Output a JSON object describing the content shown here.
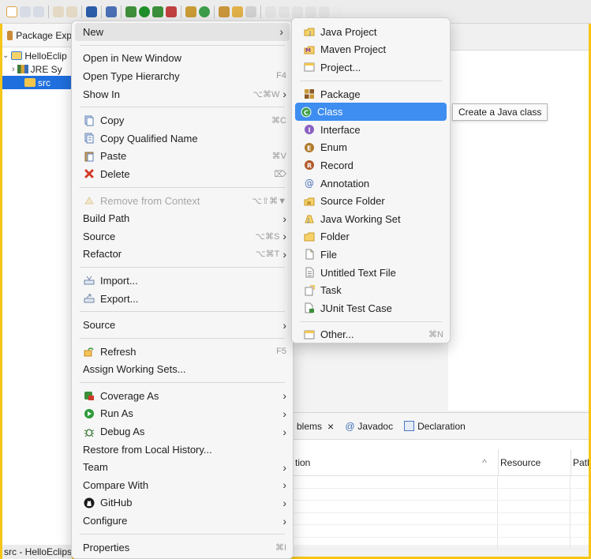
{
  "package_explorer": {
    "tab_label": "Package Exp",
    "project": "HelloEclip",
    "jre": "JRE Sy",
    "src": "src"
  },
  "status_bar": {
    "text": "src - HelloEclips"
  },
  "bottom_panel": {
    "tabs": [
      {
        "label": "blems",
        "close": "×"
      },
      {
        "label": "Javadoc"
      },
      {
        "label": "Declaration"
      }
    ],
    "columns": [
      "tion",
      "Resource",
      "Path"
    ],
    "sort_glyph": "^"
  },
  "context_menu": {
    "items": [
      {
        "label": "New",
        "arrow": true
      },
      {
        "sep": true
      },
      {
        "label": "Open in New Window"
      },
      {
        "label": "Open Type Hierarchy",
        "shortcut": "F4"
      },
      {
        "label": "Show In",
        "shortcut": "⌥⌘W",
        "arrow": true
      },
      {
        "sep": true
      },
      {
        "label": "Copy",
        "shortcut": "⌘C",
        "icon": "copy"
      },
      {
        "label": "Copy Qualified Name",
        "icon": "copy-qualified"
      },
      {
        "label": "Paste",
        "shortcut": "⌘V",
        "icon": "paste"
      },
      {
        "label": "Delete",
        "shortcut": "⌦",
        "icon": "delete"
      },
      {
        "sep": true
      },
      {
        "label": "Remove from Context",
        "shortcut": "⌥⇧⌘▼",
        "icon": "remove-context",
        "disabled": true
      },
      {
        "label": "Build Path",
        "arrow": true
      },
      {
        "label": "Source",
        "shortcut": "⌥⌘S",
        "arrow": true
      },
      {
        "label": "Refactor",
        "shortcut": "⌥⌘T",
        "arrow": true
      },
      {
        "sep": true
      },
      {
        "label": "Import...",
        "icon": "import"
      },
      {
        "label": "Export...",
        "icon": "export"
      },
      {
        "sep": true
      },
      {
        "label": "Source",
        "arrow": true
      },
      {
        "sep": true
      },
      {
        "label": "Refresh",
        "shortcut": "F5",
        "icon": "refresh"
      },
      {
        "label": "Assign Working Sets..."
      },
      {
        "sep": true
      },
      {
        "label": "Coverage As",
        "arrow": true,
        "icon": "coverage"
      },
      {
        "label": "Run As",
        "arrow": true,
        "icon": "run"
      },
      {
        "label": "Debug As",
        "arrow": true,
        "icon": "debug"
      },
      {
        "label": "Restore from Local History..."
      },
      {
        "label": "Team",
        "arrow": true
      },
      {
        "label": "Compare With",
        "arrow": true
      },
      {
        "label": "GitHub",
        "arrow": true,
        "icon": "github"
      },
      {
        "label": "Configure",
        "arrow": true
      },
      {
        "sep": true
      },
      {
        "label": "Properties",
        "shortcut": "⌘I"
      }
    ]
  },
  "new_submenu": {
    "items": [
      {
        "label": "Java Project",
        "icon": "java-project"
      },
      {
        "label": "Maven Project",
        "icon": "maven-project"
      },
      {
        "label": "Project...",
        "icon": "project"
      },
      {
        "sep": true
      },
      {
        "label": "Package",
        "icon": "package"
      },
      {
        "label": "Class",
        "icon": "class",
        "selected": true
      },
      {
        "label": "Interface",
        "icon": "interface"
      },
      {
        "label": "Enum",
        "icon": "enum"
      },
      {
        "label": "Record",
        "icon": "record"
      },
      {
        "label": "Annotation",
        "icon": "annotation"
      },
      {
        "label": "Source Folder",
        "icon": "source-folder"
      },
      {
        "label": "Java Working Set",
        "icon": "working-set"
      },
      {
        "label": "Folder",
        "icon": "folder"
      },
      {
        "label": "File",
        "icon": "file"
      },
      {
        "label": "Untitled Text File",
        "icon": "text-file"
      },
      {
        "label": "Task",
        "icon": "task"
      },
      {
        "label": "JUnit Test Case",
        "icon": "junit"
      },
      {
        "sep": true
      },
      {
        "label": "Other...",
        "shortcut": "⌘N",
        "icon": "other"
      }
    ]
  },
  "tooltip": {
    "text": "Create a Java class"
  },
  "colors": {
    "selection": "#3e8df0",
    "tree_selection": "#1f6fde",
    "frame": "#f5c518"
  }
}
